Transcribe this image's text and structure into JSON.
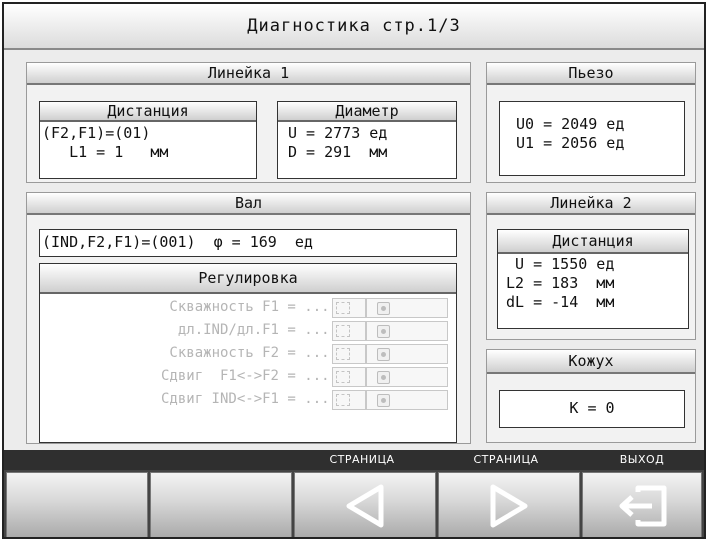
{
  "title": "Диагностика стр.1/3",
  "ruler1": {
    "header": "Линейка 1",
    "distance": {
      "header": "Дистанция",
      "line1": "(F2,F1)=(01)",
      "line2": "   L1 = 1   мм"
    },
    "diameter": {
      "header": "Диаметр",
      "line1": "U = 2773 ед",
      "line2": "D = 291  мм"
    }
  },
  "piezo": {
    "header": "Пьезо",
    "line1": "U0 = 2049 ед",
    "line2": "U1 = 2056 ед"
  },
  "shaft": {
    "header": "Вал",
    "status": "(IND,F2,F1)=(001)  φ = 169  ед",
    "regulation": {
      "header": "Регулировка",
      "rows": [
        "Скважность F1 = ....",
        "дл.IND/дл.F1 = ....",
        "Скважность F2 = ....",
        "Сдвиг  F1<->F2 = ....",
        "Сдвиг IND<->F1 = ...."
      ]
    }
  },
  "ruler2": {
    "header": "Линейка 2",
    "distance": {
      "header": "Дистанция",
      "line1": " U = 1550 ед",
      "line2": "L2 = 183  мм",
      "line3": "dL = -14  мм"
    }
  },
  "casing": {
    "header": "Кожух",
    "value": "K = 0"
  },
  "softkeys": {
    "k3": "СТРАНИЦА",
    "k4": "СТРАНИЦА",
    "k5": "ВЫХОД"
  },
  "icons": {
    "prev": "triangle-left-icon",
    "next": "triangle-right-icon",
    "exit": "exit-icon"
  }
}
